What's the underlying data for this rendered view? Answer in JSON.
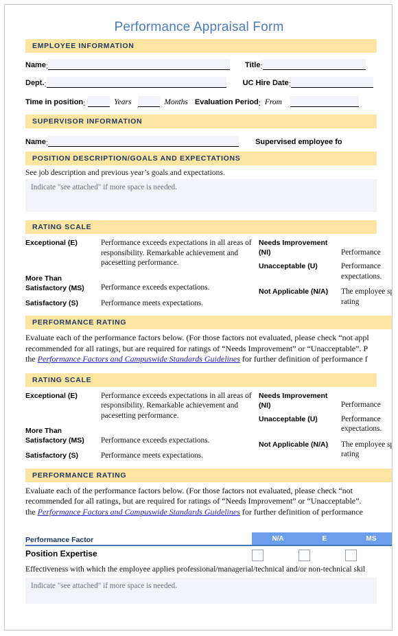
{
  "document": {
    "title": "Performance Appraisal Form",
    "title_color": "#4a7ebb",
    "section_bar_color": "#fbe5a0",
    "section_bar_text_color": "#1f3864",
    "table_header_color": "#6d9eeb",
    "link_color": "#2222cc"
  },
  "employee_information": {
    "heading": "EMPLOYEE INFORMATION",
    "name_label": "Name",
    "name_value": "",
    "title_label": "Title",
    "title_value": "",
    "dept_label": "Dept.",
    "dept_value": "",
    "hire_date_label": "UC Hire Date",
    "hire_date_value": "",
    "time_in_position_label": "Time in position",
    "years_value": "",
    "years_unit": "Years",
    "months_value": "",
    "months_unit": "Months",
    "evaluation_period_label": "Evaluation Period",
    "evaluation_from_label": "From",
    "evaluation_from_value": "",
    "colon": ":"
  },
  "supervisor_information": {
    "heading": "SUPERVISOR INFORMATION",
    "name_label": "Name",
    "name_value": "",
    "supervised_label": "Supervised employee fo"
  },
  "position_description": {
    "heading": "POSITION DESCRIPTION/GOALS AND EXPECTATIONS",
    "instruction": "See job description and previous year’s goals and expectations.",
    "placeholder": "Indicate \"see attached\" if more space is needed.",
    "value": ""
  },
  "rating_scale": {
    "heading": "RATING SCALE",
    "left_items": [
      {
        "term": "Exceptional (E)",
        "description": "Performance exceeds expectations in all areas of responsibility. Remarkable achievement and pacesetting performance."
      },
      {
        "term": "More Than Satisfactory (MS)",
        "description": "Performance exceeds expectations."
      },
      {
        "term": "Satisfactory (S)",
        "description": "Performance meets expectations."
      }
    ],
    "right_items": [
      {
        "term": "Needs Improvement (NI)",
        "description": "Performance"
      },
      {
        "term": "Unacceptable (U)",
        "description": "Performance expectations."
      },
      {
        "term": "Not Applicable (N/A)",
        "description": "The employee specific rating"
      }
    ]
  },
  "performance_rating_1": {
    "heading": "PERFORMANCE RATING",
    "line1": "Evaluate each of the performance factors below. (For those factors not evaluated, please check “not appl",
    "line2": "recommended for all ratings, but are required for ratings of “Needs Improvement” or “Unacceptable”. P",
    "line3_prefix": "the ",
    "line3_link": "Performance Factors and Campuswide Standards Guidelines",
    "line3_suffix": " for further definition of performance f"
  },
  "performance_rating_2": {
    "heading": "PERFORMANCE RATING",
    "line1": "Evaluate each of the performance factors below. (For those factors not evaluated, please check “not",
    "line2": "recommended for all ratings, but are required for ratings of “Needs Improvement” or “Unacceptable”.",
    "line3_prefix": "the ",
    "line3_link": "Performance Factors and Campuswide Standards Guidelines",
    "line3_suffix": " for further definition of performance"
  },
  "performance_factor_table": {
    "column_header": "Performance Factor",
    "rating_columns": [
      "N/A",
      "E",
      "MS"
    ],
    "rows": [
      {
        "factor": "Position Expertise",
        "description": "Effectiveness with which the employee applies professional/managerial/technical and/or non-technical skil",
        "placeholder": "Indicate \"see attached\" if more space is needed.",
        "comment_value": "",
        "checked": ""
      }
    ]
  }
}
